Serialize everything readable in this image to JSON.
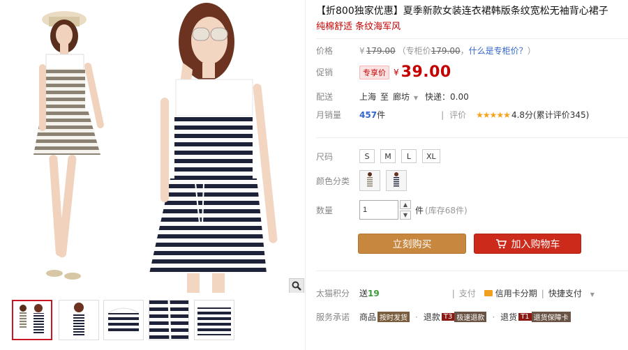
{
  "product": {
    "title": "【折800独家优惠】夏季新款女装连衣裙韩版条纹宽松无袖背心裙子",
    "subtitle": "纯棉舒适 条纹海军风"
  },
  "price": {
    "label": "价格",
    "currency": "¥",
    "original": "179.00",
    "note_open": "（专柜价",
    "note_value": "179.00",
    "note_mid": "，",
    "note_link": "什么是专柜价？",
    "note_close": "）"
  },
  "promo": {
    "label": "促销",
    "tag": "专享价",
    "currency": "¥",
    "price": "39.00"
  },
  "delivery": {
    "label": "配送",
    "from": "上海",
    "to_prefix": "至",
    "to": "廊坊",
    "fee": "快递：0.00"
  },
  "sales": {
    "label": "月销量",
    "count": "457",
    "unit": "件",
    "rating_label": "评价",
    "stars": "★★★★★",
    "score": "4.8分",
    "reviews": "(累计评价345)"
  },
  "size": {
    "label": "尺码",
    "options": [
      "S",
      "M",
      "L",
      "XL"
    ]
  },
  "color": {
    "label": "颜色分类",
    "options": [
      "grey-stripe-dress",
      "navy-stripe-dress"
    ]
  },
  "quantity": {
    "label": "数量",
    "value": "1",
    "unit": "件",
    "stock": "(库存68件)"
  },
  "actions": {
    "buy_now": "立刻购买",
    "add_cart": "加入购物车"
  },
  "points": {
    "label": "太猫积分",
    "text_prefix": "送",
    "amount": "19",
    "pay_label": "支付",
    "credit": "信用卡分期",
    "quick": "快捷支付"
  },
  "service": {
    "label": "服务承诺",
    "item1": "商品",
    "badge1": "按时发货",
    "item2": "退款",
    "badge2_code": "T3",
    "badge2": "极速退款",
    "item3": "退货",
    "badge3_code": "T1",
    "badge3": "退货保障卡"
  },
  "colors": {
    "accent_red": "#c40000",
    "buy_button": "#c8873e",
    "cart_button": "#cc2a1b",
    "star": "#f7a21b"
  }
}
